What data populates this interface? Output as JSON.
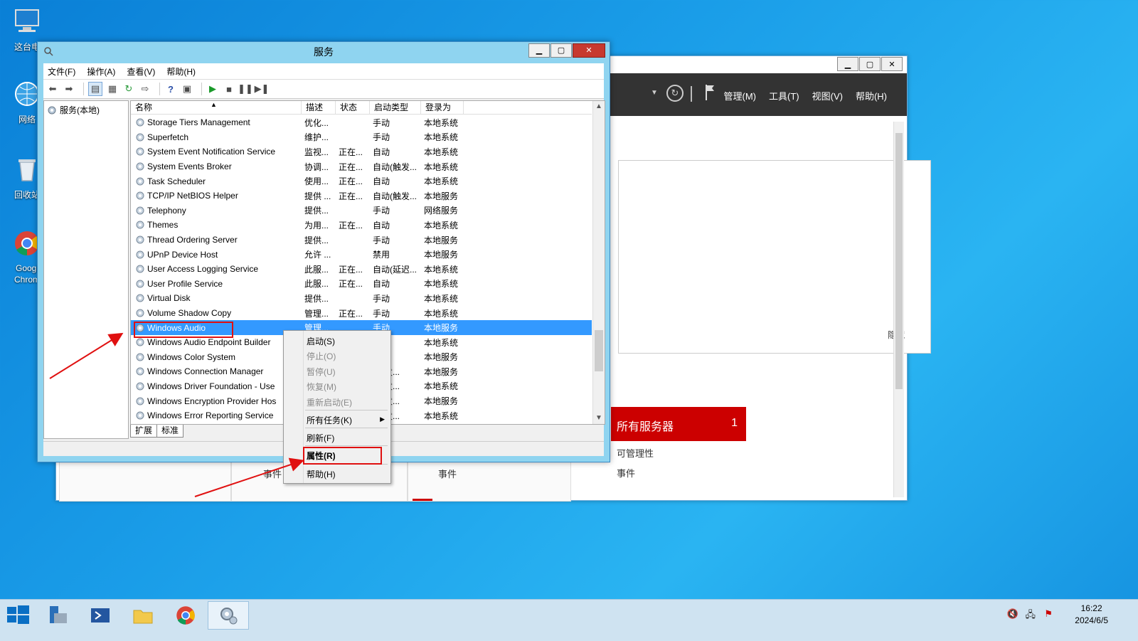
{
  "desktop": {
    "icons": [
      {
        "label": "这台电",
        "name": "this-pc"
      },
      {
        "label": "网络",
        "name": "network"
      },
      {
        "label": "回收站",
        "name": "recycle-bin"
      },
      {
        "label": "Googl Chrom",
        "name": "google-chrome"
      }
    ]
  },
  "server_manager": {
    "menu": [
      "管理(M)",
      "工具(T)",
      "视图(V)",
      "帮助(H)"
    ],
    "hide_label": "隐藏",
    "all_servers_label": "所有服务器",
    "all_servers_count": "1",
    "manageability": "可管理性",
    "events": "事件",
    "tiles": [
      "事件",
      "事件"
    ]
  },
  "services": {
    "title": "服务",
    "menu": [
      "文件(F)",
      "操作(A)",
      "查看(V)",
      "帮助(H)"
    ],
    "tree_root": "服务(本地)",
    "columns": [
      "名称",
      "描述",
      "状态",
      "启动类型",
      "登录为"
    ],
    "rows": [
      {
        "name": "Storage Tiers Management",
        "desc": "优化...",
        "status": "",
        "startup": "手动",
        "logon": "本地系统"
      },
      {
        "name": "Superfetch",
        "desc": "维护...",
        "status": "",
        "startup": "手动",
        "logon": "本地系统"
      },
      {
        "name": "System Event Notification Service",
        "desc": "监视...",
        "status": "正在...",
        "startup": "自动",
        "logon": "本地系统"
      },
      {
        "name": "System Events Broker",
        "desc": "协调...",
        "status": "正在...",
        "startup": "自动(触发...",
        "logon": "本地系统"
      },
      {
        "name": "Task Scheduler",
        "desc": "使用...",
        "status": "正在...",
        "startup": "自动",
        "logon": "本地系统"
      },
      {
        "name": "TCP/IP NetBIOS Helper",
        "desc": "提供 ...",
        "status": "正在...",
        "startup": "自动(触发...",
        "logon": "本地服务"
      },
      {
        "name": "Telephony",
        "desc": "提供...",
        "status": "",
        "startup": "手动",
        "logon": "网络服务"
      },
      {
        "name": "Themes",
        "desc": "为用...",
        "status": "正在...",
        "startup": "自动",
        "logon": "本地系统"
      },
      {
        "name": "Thread Ordering Server",
        "desc": "提供...",
        "status": "",
        "startup": "手动",
        "logon": "本地服务"
      },
      {
        "name": "UPnP Device Host",
        "desc": "允许 ...",
        "status": "",
        "startup": "禁用",
        "logon": "本地服务"
      },
      {
        "name": "User Access Logging Service",
        "desc": "此服...",
        "status": "正在...",
        "startup": "自动(延迟...",
        "logon": "本地系统"
      },
      {
        "name": "User Profile Service",
        "desc": "此服...",
        "status": "正在...",
        "startup": "自动",
        "logon": "本地系统"
      },
      {
        "name": "Virtual Disk",
        "desc": "提供...",
        "status": "",
        "startup": "手动",
        "logon": "本地系统"
      },
      {
        "name": "Volume Shadow Copy",
        "desc": "管理...",
        "status": "正在...",
        "startup": "手动",
        "logon": "本地系统"
      },
      {
        "name": "Windows Audio",
        "desc": "管理...",
        "status": "",
        "startup": "手动",
        "logon": "本地服务",
        "selected": true
      },
      {
        "name": "Windows Audio Endpoint Builder",
        "desc": "",
        "status": "",
        "startup": "",
        "logon": "本地系统"
      },
      {
        "name": "Windows Color System",
        "desc": "",
        "status": "",
        "startup": "",
        "logon": "本地服务"
      },
      {
        "name": "Windows Connection Manager",
        "desc": "",
        "status": "",
        "startup": "(触发...",
        "logon": "本地服务"
      },
      {
        "name": "Windows Driver Foundation - Use",
        "desc": "",
        "status": "",
        "startup": "(触发...",
        "logon": "本地系统"
      },
      {
        "name": "Windows Encryption Provider Hos",
        "desc": "",
        "status": "",
        "startup": "(触发...",
        "logon": "本地服务"
      },
      {
        "name": "Windows Error Reporting Service",
        "desc": "",
        "status": "",
        "startup": "(触发...",
        "logon": "本地系统"
      }
    ],
    "tabs": [
      "扩展",
      "标准"
    ]
  },
  "context_menu": {
    "items": [
      {
        "label": "启动(S)",
        "disabled": false
      },
      {
        "label": "停止(O)",
        "disabled": true
      },
      {
        "label": "暂停(U)",
        "disabled": true
      },
      {
        "label": "恢复(M)",
        "disabled": true
      },
      {
        "label": "重新启动(E)",
        "disabled": true
      },
      {
        "label": "所有任务(K)",
        "disabled": false
      },
      {
        "label": "刷新(F)",
        "disabled": false
      },
      {
        "label": "属性(R)",
        "disabled": false
      },
      {
        "label": "帮助(H)",
        "disabled": false
      }
    ]
  },
  "taskbar": {
    "apps": [
      "server-manager",
      "powershell",
      "file-explorer",
      "chrome",
      "services"
    ],
    "time": "16:22",
    "date": "2024/6/5"
  },
  "colors": {
    "accent": "#3399ff",
    "annotation": "#e01010",
    "server_red": "#c00000"
  }
}
